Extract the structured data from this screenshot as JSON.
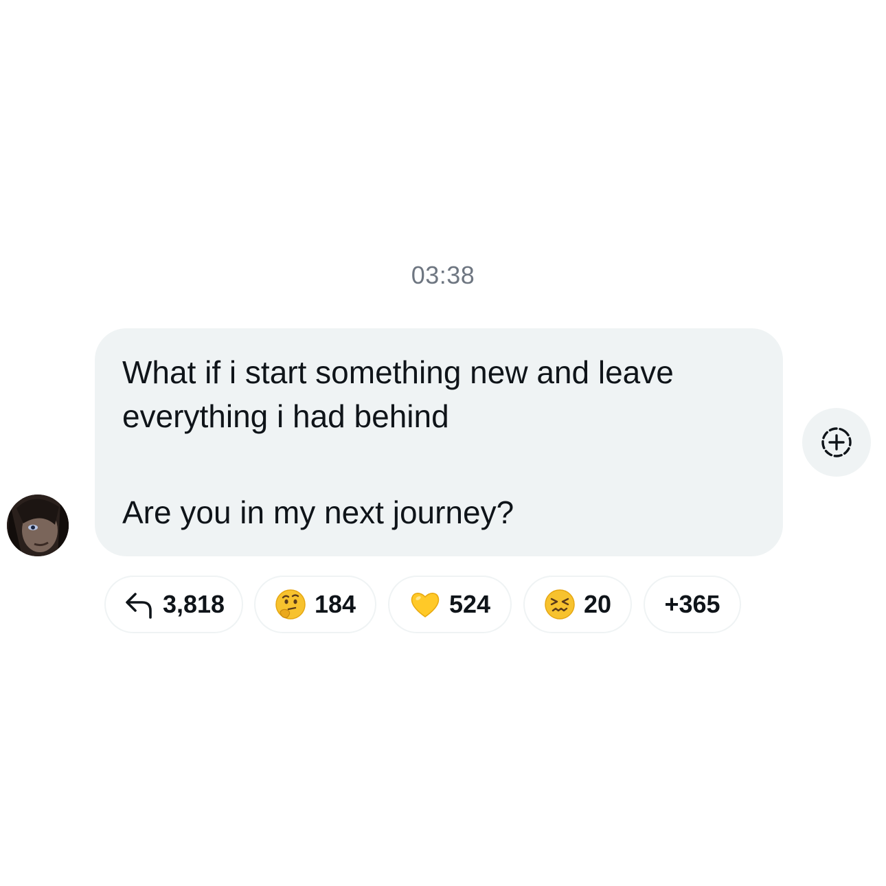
{
  "timestamp": "03:38",
  "message": {
    "paragraph_1": "What if i start something new and leave everything i had behind",
    "paragraph_2": "Are you in my next journey?"
  },
  "reactions": [
    {
      "icon": "reply-arrow-icon",
      "count": "3,818"
    },
    {
      "icon": "thinking-face-emoji",
      "count": "184"
    },
    {
      "icon": "yellow-heart-emoji",
      "count": "524"
    },
    {
      "icon": "persevering-face-emoji",
      "count": "20"
    },
    {
      "icon": "none",
      "count": "+365"
    }
  ],
  "add_reaction": {
    "icon": "add-reaction-icon"
  },
  "colors": {
    "bubble_bg": "#eff3f4",
    "text": "#0f1419",
    "timestamp": "#6e7681"
  }
}
